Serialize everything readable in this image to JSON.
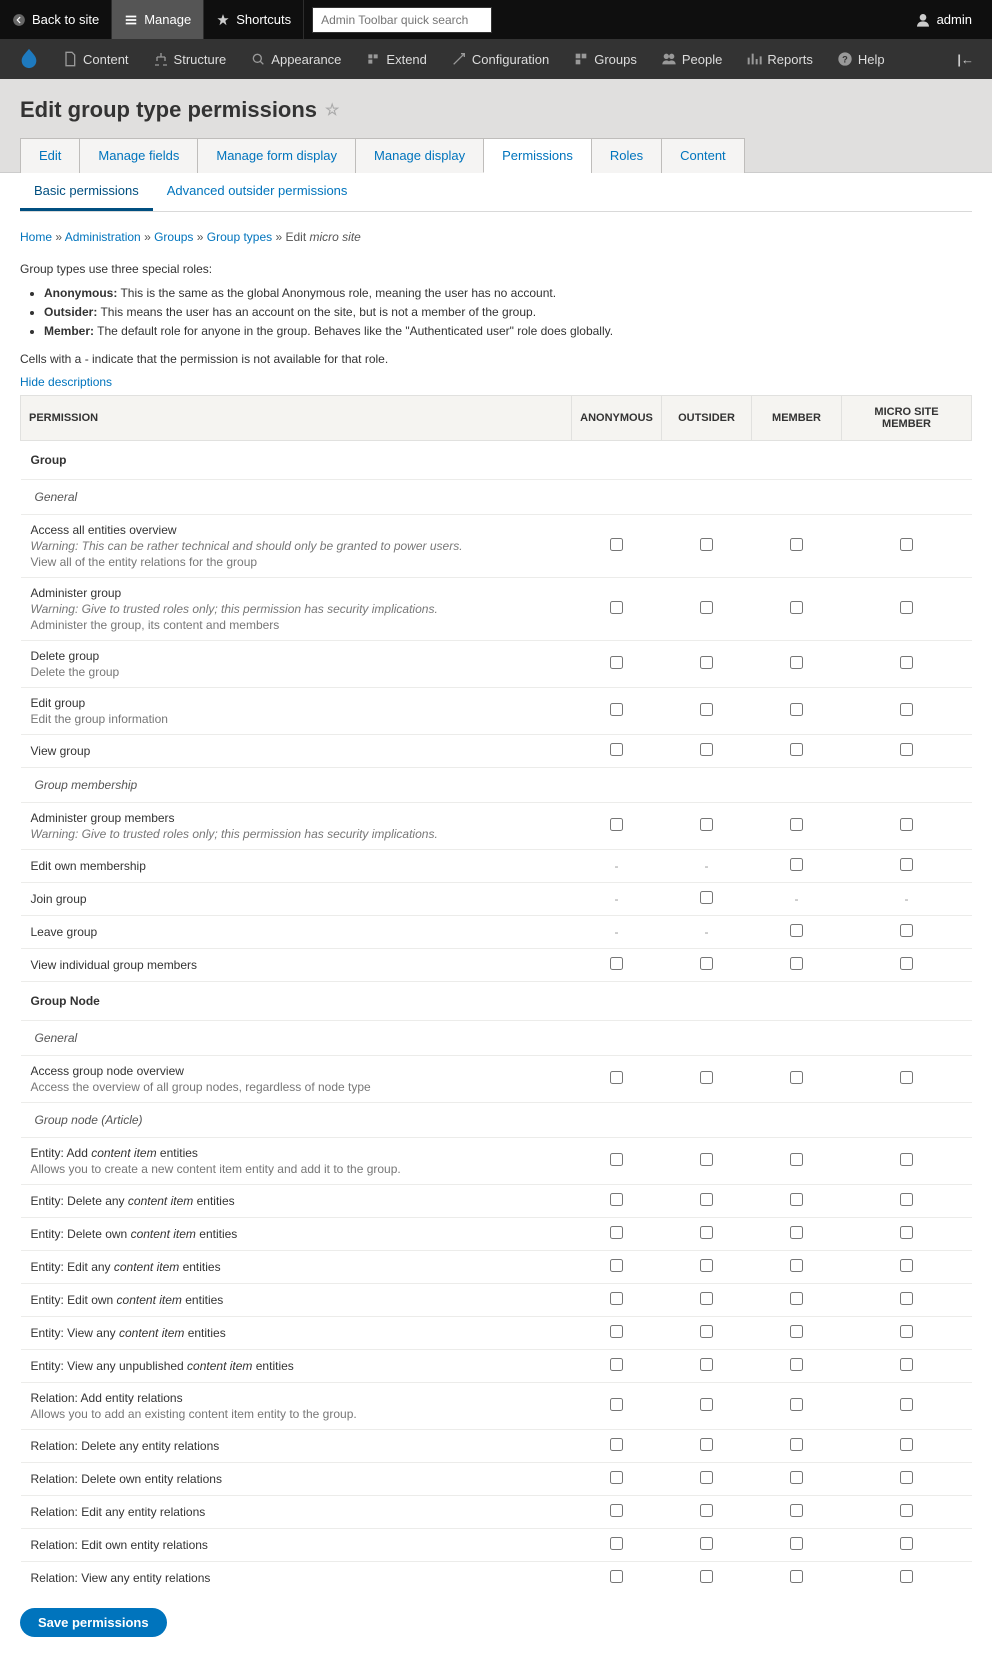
{
  "topbar": {
    "back": "Back to site",
    "manage": "Manage",
    "shortcuts": "Shortcuts",
    "search_placeholder": "Admin Toolbar quick search",
    "user": "admin"
  },
  "admin_menu": {
    "items": [
      "Content",
      "Structure",
      "Appearance",
      "Extend",
      "Configuration",
      "Groups",
      "People",
      "Reports",
      "Help"
    ]
  },
  "page": {
    "title": "Edit group type permissions",
    "primary_tabs": [
      "Edit",
      "Manage fields",
      "Manage form display",
      "Manage display",
      "Permissions",
      "Roles",
      "Content"
    ],
    "active_primary": 4,
    "secondary_tabs": [
      "Basic permissions",
      "Advanced outsider permissions"
    ],
    "active_secondary": 0
  },
  "breadcrumb": {
    "parts": [
      "Home",
      "Administration",
      "Groups",
      "Group types"
    ],
    "last_prefix": "Edit ",
    "last_em": "micro site"
  },
  "intro": "Group types use three special roles:",
  "roles_desc": [
    {
      "b": "Anonymous:",
      "t": " This is the same as the global Anonymous role, meaning the user has no account."
    },
    {
      "b": "Outsider:",
      "t": " This means the user has an account on the site, but is not a member of the group."
    },
    {
      "b": "Member:",
      "t": " The default role for anyone in the group. Behaves like the \"Authenticated user\" role does globally."
    }
  ],
  "cells_note": "Cells with a - indicate that the permission is not available for that role.",
  "hide_desc": "Hide descriptions",
  "thead": {
    "perm": "PERMISSION",
    "anon": "ANONYMOUS",
    "out": "OUTSIDER",
    "mem": "MEMBER",
    "msm": "MICRO SITE MEMBER"
  },
  "sections": [
    {
      "title": "Group",
      "subs": [
        {
          "title": "General",
          "rows": [
            {
              "name": "Access all entities overview",
              "warn": "Warning: This can be rather technical and should only be granted to power users.",
              "desc": "View all of the entity relations for the group",
              "cells": [
                "cb",
                "cb",
                "cb",
                "cb"
              ]
            },
            {
              "name": "Administer group",
              "warn": "Warning: Give to trusted roles only; this permission has security implications.",
              "desc": "Administer the group, its content and members",
              "cells": [
                "cb",
                "cb",
                "cb",
                "cb"
              ]
            },
            {
              "name": "Delete group",
              "desc": "Delete the group",
              "cells": [
                "cb",
                "cb",
                "cb",
                "cb"
              ]
            },
            {
              "name": "Edit group",
              "desc": "Edit the group information",
              "cells": [
                "cb",
                "cb",
                "cb",
                "cb"
              ]
            },
            {
              "name": "View group",
              "cells": [
                "cb",
                "cb",
                "cb",
                "cb"
              ]
            }
          ]
        },
        {
          "title": "Group membership",
          "rows": [
            {
              "name": "Administer group members",
              "warn": "Warning: Give to trusted roles only; this permission has security implications.",
              "cells": [
                "cb",
                "cb",
                "cb",
                "cb"
              ]
            },
            {
              "name": "Edit own membership",
              "cells": [
                "-",
                "-",
                "cb",
                "cb"
              ]
            },
            {
              "name": "Join group",
              "cells": [
                "-",
                "cb",
                "-",
                "-"
              ]
            },
            {
              "name": "Leave group",
              "cells": [
                "-",
                "-",
                "cb",
                "cb"
              ]
            },
            {
              "name": "View individual group members",
              "cells": [
                "cb",
                "cb",
                "cb",
                "cb"
              ]
            }
          ]
        }
      ]
    },
    {
      "title": "Group Node",
      "subs": [
        {
          "title": "General",
          "rows": [
            {
              "name": "Access group node overview",
              "desc": "Access the overview of all group nodes, regardless of node type",
              "cells": [
                "cb",
                "cb",
                "cb",
                "cb"
              ]
            }
          ]
        },
        {
          "title": "Group node (Article)",
          "rows": [
            {
              "name_parts": [
                "Entity: Add ",
                "content item",
                " entities"
              ],
              "desc_parts": [
                "Allows you to create a new ",
                "content item",
                " entity and add it to the group."
              ],
              "cells": [
                "cb",
                "cb",
                "cb",
                "cb"
              ]
            },
            {
              "name_parts": [
                "Entity: Delete any ",
                "content item",
                " entities"
              ],
              "cells": [
                "cb",
                "cb",
                "cb",
                "cb"
              ]
            },
            {
              "name_parts": [
                "Entity: Delete own ",
                "content item",
                " entities"
              ],
              "cells": [
                "cb",
                "cb",
                "cb",
                "cb"
              ]
            },
            {
              "name_parts": [
                "Entity: Edit any ",
                "content item",
                " entities"
              ],
              "cells": [
                "cb",
                "cb",
                "cb",
                "cb"
              ]
            },
            {
              "name_parts": [
                "Entity: Edit own ",
                "content item",
                " entities"
              ],
              "cells": [
                "cb",
                "cb",
                "cb",
                "cb"
              ]
            },
            {
              "name_parts": [
                "Entity: View any ",
                "content item",
                " entities"
              ],
              "cells": [
                "cb",
                "cb",
                "cb",
                "cb"
              ]
            },
            {
              "name_parts": [
                "Entity: View any unpublished ",
                "content item",
                " entities"
              ],
              "cells": [
                "cb",
                "cb",
                "cb",
                "cb"
              ]
            },
            {
              "name": "Relation: Add entity relations",
              "desc_parts": [
                "Allows you to add an existing ",
                "content item",
                " entity to the group."
              ],
              "cells": [
                "cb",
                "cb",
                "cb",
                "cb"
              ]
            },
            {
              "name": "Relation: Delete any entity relations",
              "cells": [
                "cb",
                "cb",
                "cb",
                "cb"
              ]
            },
            {
              "name": "Relation: Delete own entity relations",
              "cells": [
                "cb",
                "cb",
                "cb",
                "cb"
              ]
            },
            {
              "name": "Relation: Edit any entity relations",
              "cells": [
                "cb",
                "cb",
                "cb",
                "cb"
              ]
            },
            {
              "name": "Relation: Edit own entity relations",
              "cells": [
                "cb",
                "cb",
                "cb",
                "cb"
              ]
            },
            {
              "name": "Relation: View any entity relations",
              "cells": [
                "cb",
                "cb",
                "cb",
                "cb"
              ]
            }
          ]
        }
      ]
    }
  ],
  "save": "Save permissions"
}
